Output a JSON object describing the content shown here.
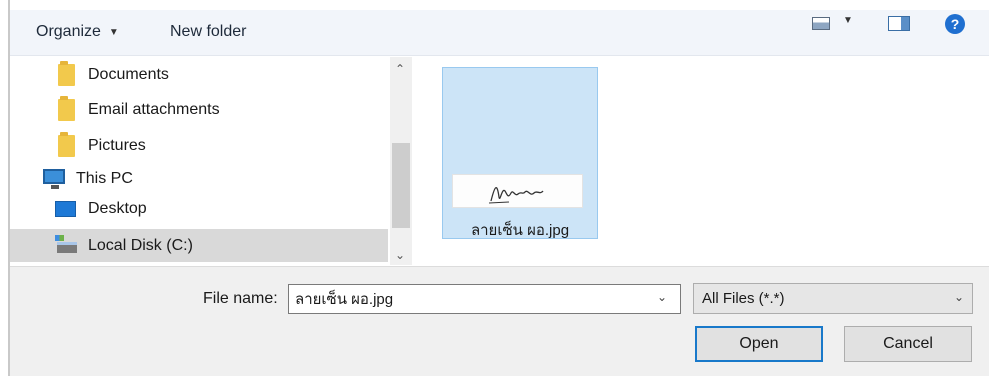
{
  "toolbar": {
    "organize_label": "Organize",
    "new_folder_label": "New folder",
    "help_glyph": "?"
  },
  "nav": {
    "items": [
      {
        "label": "Documents",
        "icon": "folder-icon"
      },
      {
        "label": "Email attachments",
        "icon": "folder-icon"
      },
      {
        "label": "Pictures",
        "icon": "folder-icon"
      },
      {
        "label": "This PC",
        "icon": "computer-icon"
      },
      {
        "label": "Desktop",
        "icon": "desktop-icon"
      },
      {
        "label": "Local Disk (C:)",
        "icon": "drive-icon",
        "selected": true
      }
    ]
  },
  "files": [
    {
      "name": "ลายเซ็น ผอ.jpg",
      "selected": true
    }
  ],
  "bottom": {
    "file_name_label": "File name:",
    "file_name_value": "ลายเซ็น ผอ.jpg",
    "file_type_value": "All Files (*.*)",
    "open_label": "Open",
    "cancel_label": "Cancel"
  },
  "colors": {
    "selection_fill": "#cce4f7",
    "selection_border": "#99c9ef",
    "primary_button_border": "#1979ca",
    "help_icon": "#1f6fd0"
  }
}
